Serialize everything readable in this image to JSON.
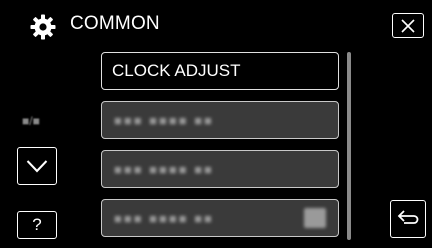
{
  "header": {
    "title": "COMMON",
    "icon": "gear-icon",
    "close_icon": "close-icon"
  },
  "menu": {
    "items": [
      {
        "label": "CLOCK ADJUST",
        "selected": true
      },
      {
        "label": "■■■ ■■■■ ■■",
        "blurred": true
      },
      {
        "label": "■■■ ■■■■ ■■",
        "blurred": true
      },
      {
        "label": "■■■ ■■■■ ■■",
        "blurred": true,
        "has_toggle": true
      }
    ]
  },
  "side": {
    "page_indicator": "■/■",
    "down_icon": "chevron-down-icon",
    "help_label": "?"
  },
  "footer": {
    "back_icon": "return-icon"
  },
  "colors": {
    "background": "#000000",
    "text": "#ffffff",
    "item_background": "#3a3a3a"
  }
}
